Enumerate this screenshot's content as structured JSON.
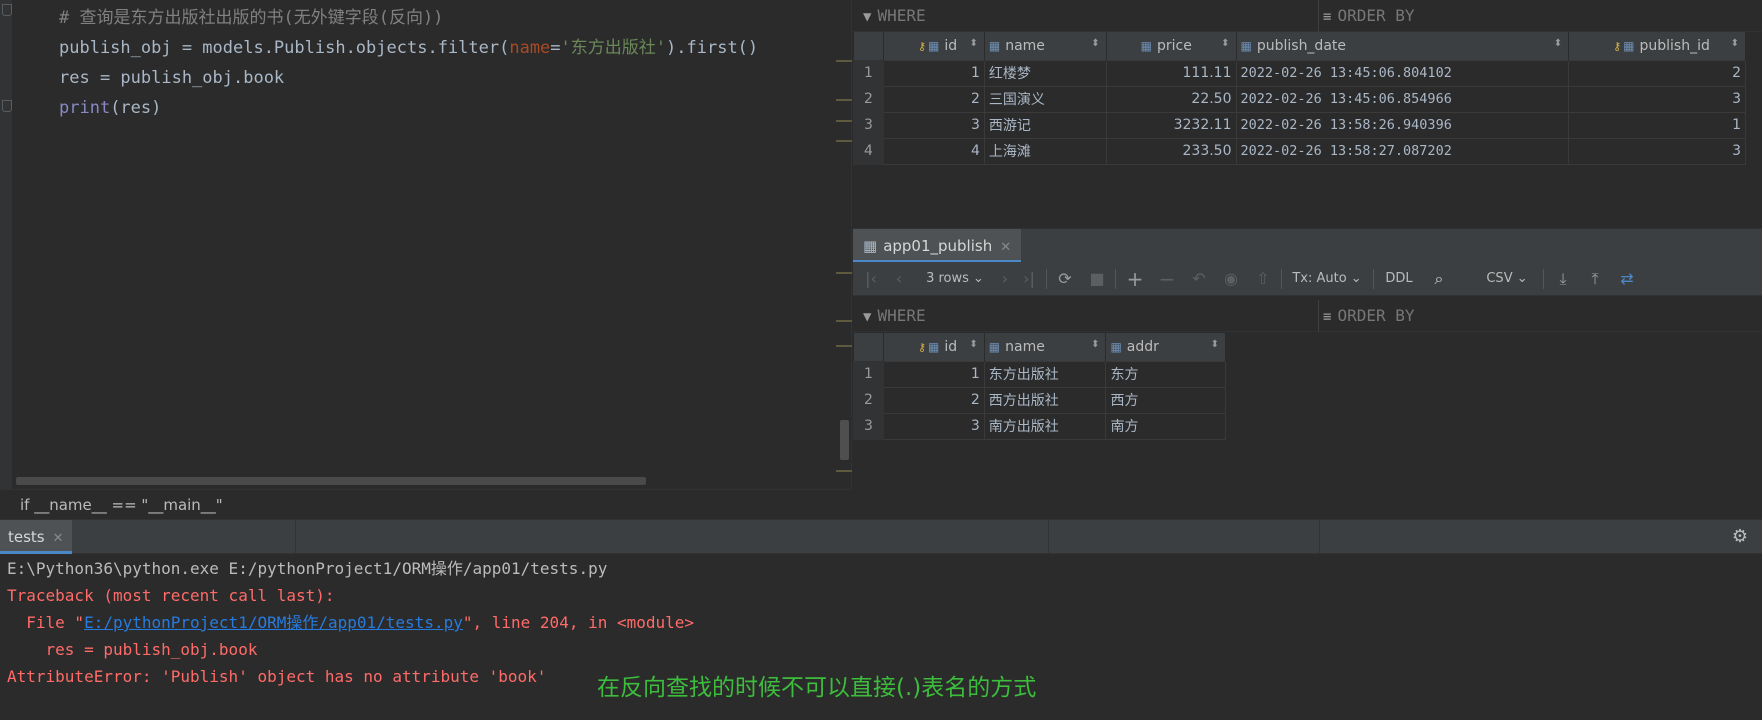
{
  "editor": {
    "lines": [
      {
        "comment": "# 查询是东方出版社出版的书(无外键字段(反向))"
      },
      {
        "prefix": "publish_obj = models.Publish.objects.filter(",
        "param": "name",
        "eq": "=",
        "str": "'东方出版社'",
        "suffix": ").first()"
      },
      {
        "text": "res = publish_obj.book"
      },
      {
        "builtin": "print",
        "rest": "(res)"
      }
    ],
    "breadcrumb": "if __name__ == \"__main__\""
  },
  "books_grid": {
    "filter": {
      "where": "WHERE",
      "order_by": "ORDER BY"
    },
    "columns": [
      "id",
      "name",
      "price",
      "publish_date",
      "publish_id"
    ],
    "rows": [
      {
        "row": "1",
        "id": "1",
        "name": "红楼梦",
        "price": "111.11",
        "publish_date": "2022-02-26 13:45:06.804102",
        "publish_id": "2"
      },
      {
        "row": "2",
        "id": "2",
        "name": "三国演义",
        "price": "22.50",
        "publish_date": "2022-02-26 13:45:06.854966",
        "publish_id": "3"
      },
      {
        "row": "3",
        "id": "3",
        "name": "西游记",
        "price": "3232.11",
        "publish_date": "2022-02-26 13:58:26.940396",
        "publish_id": "1"
      },
      {
        "row": "4",
        "id": "4",
        "name": "上海滩",
        "price": "233.50",
        "publish_date": "2022-02-26 13:58:27.087202",
        "publish_id": "3"
      }
    ]
  },
  "publish_tab": {
    "title": "app01_publish"
  },
  "toolbar": {
    "rows": "3 rows",
    "tx": "Tx: Auto",
    "ddl": "DDL",
    "format": "CSV"
  },
  "publish_grid": {
    "filter": {
      "where": "WHERE",
      "order_by": "ORDER BY"
    },
    "columns": [
      "id",
      "name",
      "addr"
    ],
    "rows": [
      {
        "row": "1",
        "id": "1",
        "name": "东方出版社",
        "addr": "东方"
      },
      {
        "row": "2",
        "id": "2",
        "name": "西方出版社",
        "addr": "西方"
      },
      {
        "row": "3",
        "id": "3",
        "name": "南方出版社",
        "addr": "南方"
      }
    ]
  },
  "run": {
    "tab": "tests",
    "cmd": "E:\\Python36\\python.exe E:/pythonProject1/ORM操作/app01/tests.py",
    "traceback": "Traceback (most recent call last):",
    "file_prefix": "  File \"",
    "file_link": "E:/pythonProject1/ORM操作/app01/tests.py",
    "file_suffix": "\", line 204, in <module>",
    "code": "    res = publish_obj.book",
    "error": "AttributeError: 'Publish' object has no attribute 'book'",
    "annotation": "在反向查找的时候不可以直接(.)表名的方式"
  }
}
